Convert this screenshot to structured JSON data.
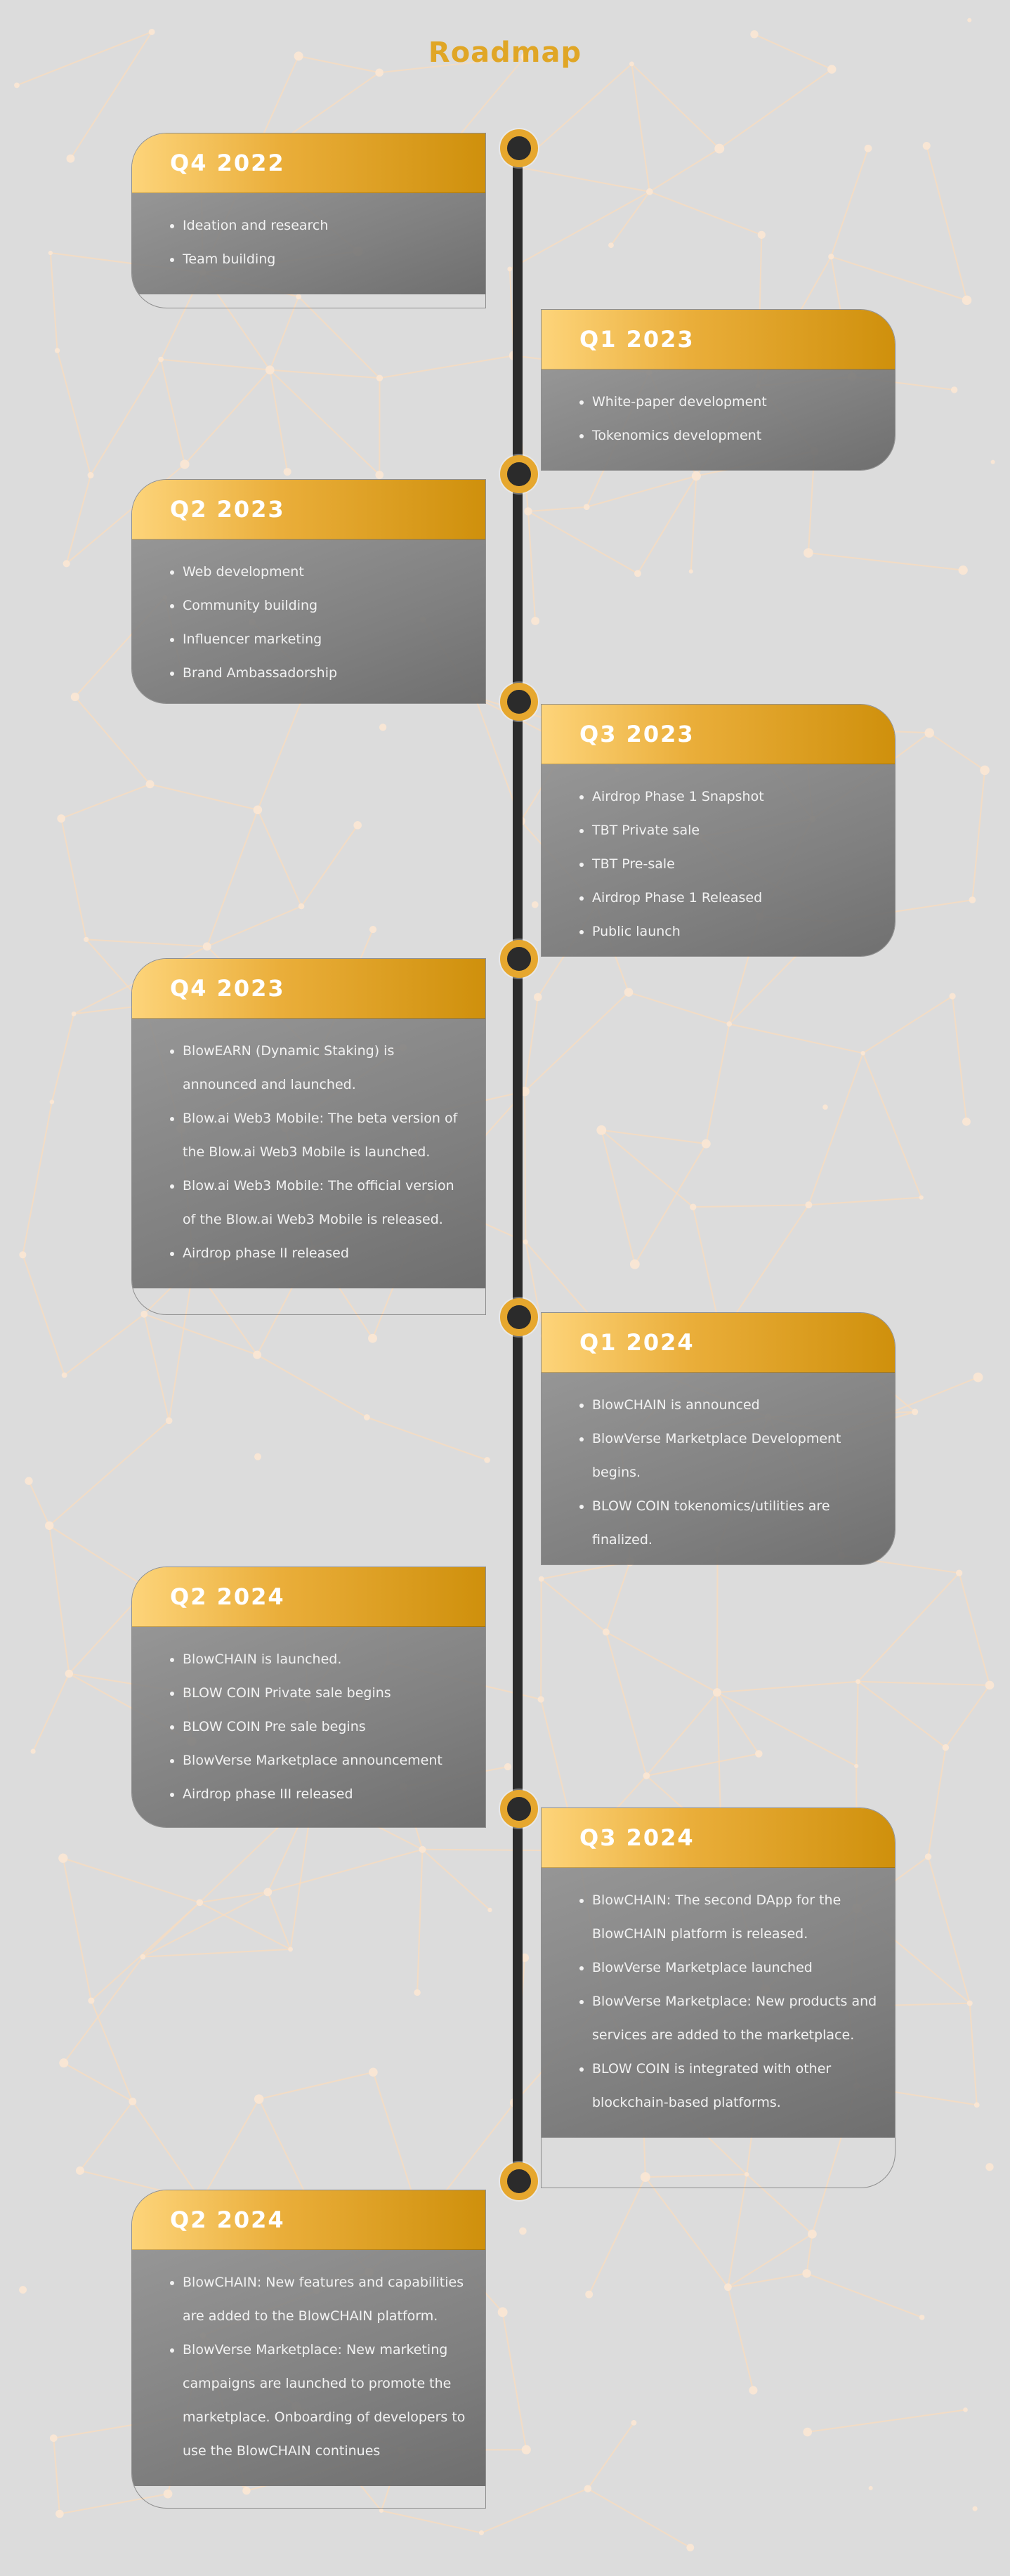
{
  "page_title": "Roadmap",
  "colors": {
    "background": "#dcdcdc",
    "accent_gold": "#e0a626",
    "header_gradient_start": "#fdd47a",
    "header_gradient_end": "#cf900c",
    "card_body": "#7f7f7f",
    "timeline": "#2b2b2b"
  },
  "cards": [
    {
      "title": "Q4 2022",
      "side": "left",
      "items": [
        "Ideation and research",
        "Team building"
      ]
    },
    {
      "title": "Q1 2023",
      "side": "right",
      "items": [
        "White-paper development",
        "Tokenomics development"
      ]
    },
    {
      "title": "Q2 2023",
      "side": "left",
      "items": [
        "Web development",
        "Community building",
        "Influencer marketing",
        "Brand Ambassadorship"
      ]
    },
    {
      "title": "Q3 2023",
      "side": "right",
      "items": [
        "Airdrop Phase 1 Snapshot",
        "TBT Private sale",
        "TBT Pre-sale",
        "Airdrop Phase 1 Released",
        "Public launch"
      ]
    },
    {
      "title": "Q4 2023",
      "side": "left",
      "items": [
        "BlowEARN (Dynamic Staking) is announced and launched.",
        "Blow.ai Web3 Mobile: The beta version of the Blow.ai Web3 Mobile is launched.",
        "Blow.ai Web3 Mobile: The official version of the Blow.ai Web3 Mobile is released.",
        "Airdrop phase II released"
      ]
    },
    {
      "title": "Q1 2024",
      "side": "right",
      "items": [
        "BlowCHAIN is announced",
        "BlowVerse Marketplace Development begins.",
        "BLOW COIN tokenomics/utilities are finalized."
      ]
    },
    {
      "title": "Q2 2024",
      "side": "left",
      "items": [
        "BlowCHAIN is launched.",
        "BLOW COIN Private sale begins",
        "BLOW COIN Pre sale begins",
        "BlowVerse Marketplace announcement",
        "Airdrop phase III released"
      ]
    },
    {
      "title": "Q3 2024",
      "side": "right",
      "items": [
        "BlowCHAIN: The second DApp for the BlowCHAIN platform is released.",
        "BlowVerse Marketplace launched",
        "BlowVerse Marketplace: New products and services are added to the marketplace.",
        "BLOW COIN is integrated with other blockchain-based platforms."
      ]
    },
    {
      "title": "Q2 2024",
      "side": "left",
      "items": [
        "BlowCHAIN: New features and capabilities are added to the BlowCHAIN platform.",
        "BlowVerse Marketplace: New marketing campaigns are launched to promote the marketplace. Onboarding of developers to use the BlowCHAIN continues"
      ]
    }
  ]
}
